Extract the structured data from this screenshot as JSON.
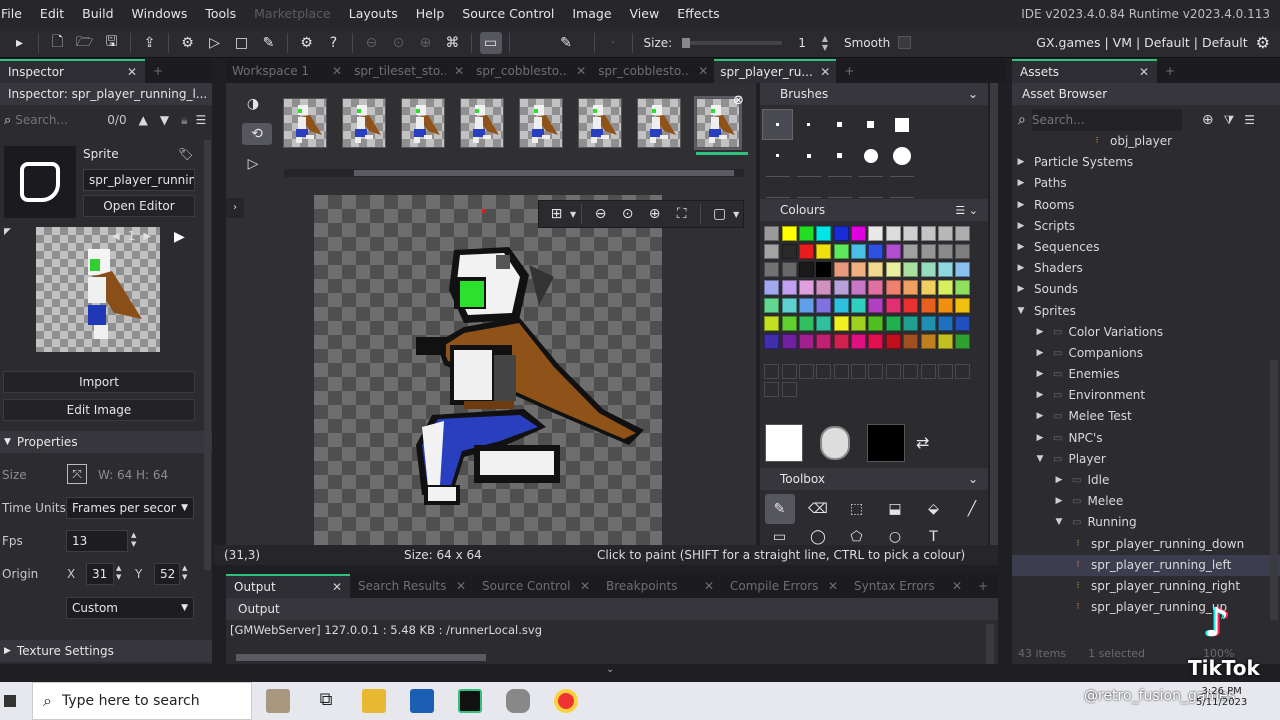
{
  "menu": {
    "items": [
      "File",
      "Edit",
      "Build",
      "Windows",
      "Tools",
      "Marketplace",
      "Layouts",
      "Help",
      "Source Control",
      "Image",
      "View",
      "Effects"
    ],
    "disabled_index": 5,
    "version": "IDE v2023.4.0.84  Runtime v2023.4.0.113"
  },
  "toolbar": {
    "size_label": "Size:",
    "size_value": "1",
    "smooth_label": "Smooth",
    "targets": "GX.games | VM | Default | Default"
  },
  "inspector": {
    "tab": "Inspector",
    "title": "Inspector: spr_player_running_l...",
    "search_placeholder": "Search...",
    "search_count": "0/0",
    "sprite_label": "Sprite",
    "sprite_name": "spr_player_running_",
    "open_editor": "Open Editor",
    "frame_number": "1",
    "import": "Import",
    "edit_image": "Edit Image",
    "properties": "Properties",
    "size_label": "Size",
    "width": "W: 64",
    "height": "H: 64",
    "time_units_label": "Time Units",
    "time_units_value": "Frames per second",
    "fps_label": "Fps",
    "fps_value": "13",
    "origin_label": "Origin",
    "origin_x_label": "X",
    "origin_x": "31",
    "origin_y_label": "Y",
    "origin_y": "52",
    "origin_preset": "Custom",
    "texture_settings": "Texture Settings"
  },
  "workspace_tabs": [
    {
      "label": "Workspace 1",
      "active": false
    },
    {
      "label": "spr_tileset_sto...",
      "active": false
    },
    {
      "label": "spr_cobblesto...",
      "active": false
    },
    {
      "label": "spr_cobblesto...",
      "active": false
    },
    {
      "label": "spr_player_ru...",
      "active": true
    }
  ],
  "editor": {
    "frames_count": 8,
    "status_coords": "(31,3)",
    "status_size": "Size: 64 x 64",
    "status_hint": "Click to paint (SHIFT for a straight line, CTRL to pick a colour)"
  },
  "brushes": {
    "title": "Brushes"
  },
  "colours": {
    "title": "Colours",
    "swatches": [
      "#9a9a9a",
      "#ffff00",
      "#22dd22",
      "#00e5e5",
      "#1a2bd8",
      "#e000e0",
      "#e8e8e8",
      "#dcdcdc",
      "#cfcfcf",
      "#c4c4c4",
      "#b8b8b8",
      "#adadad",
      "#a3a3a3",
      "#2a2a2a",
      "#e81c1c",
      "#f0e010",
      "#5ee85e",
      "#4ac0e8",
      "#3050e0",
      "#b050d0",
      "#a0a0a0",
      "#969696",
      "#8a8a8a",
      "#7e7e7e",
      "#727272",
      "#686868",
      "#1a1a1a",
      "#000000",
      "#e89a7c",
      "#f0b080",
      "#f0d890",
      "#e8f0a0",
      "#a8e0a0",
      "#98dcc0",
      "#90d8e0",
      "#88c0f0",
      "#a0a8f0",
      "#c0a0f0",
      "#e0a0e0",
      "#d090c0",
      "#b8a0d8",
      "#c878c8",
      "#e070a0",
      "#f08070",
      "#f0a060",
      "#f0d060",
      "#d8f060",
      "#90e060",
      "#60d890",
      "#60d0d0",
      "#60a0e8",
      "#8070e0",
      "#30c0e0",
      "#30d0c0",
      "#b040c0",
      "#e03070",
      "#e83030",
      "#e86020",
      "#f09010",
      "#f0c010",
      "#c0e020",
      "#60d030",
      "#30c060",
      "#30c0a0",
      "#f0f020",
      "#a0d020",
      "#50c020",
      "#20b050",
      "#20a090",
      "#2090b0",
      "#2070c0",
      "#2050c0",
      "#4030b0",
      "#7020a0",
      "#a02090",
      "#c02070",
      "#d02050",
      "#e01080",
      "#e01050",
      "#c01020",
      "#a05020",
      "#c08020",
      "#c0c020",
      "#30a030"
    ],
    "primary": "#ffffff",
    "secondary": "#000000"
  },
  "toolbox": {
    "title": "Toolbox"
  },
  "output": {
    "tabs": [
      {
        "label": "Output",
        "active": true
      },
      {
        "label": "Search Results",
        "active": false
      },
      {
        "label": "Source Control",
        "active": false
      },
      {
        "label": "Breakpoints",
        "active": false
      },
      {
        "label": "Compile Errors",
        "active": false
      },
      {
        "label": "Syntax Errors",
        "active": false
      }
    ],
    "header": "Output",
    "line": "[GMWebServer] 127.0.0.1 : 5.48 KB : /runnerLocal.svg"
  },
  "assets": {
    "tab": "Assets",
    "browser_title": "Asset Browser",
    "search_placeholder": "Search...",
    "items": [
      {
        "label": "obj_player",
        "depth": 4,
        "arrow": "",
        "selected": false
      },
      {
        "label": "Particle Systems",
        "depth": 0,
        "arrow": "right",
        "selected": false
      },
      {
        "label": "Paths",
        "depth": 0,
        "arrow": "right",
        "selected": false
      },
      {
        "label": "Rooms",
        "depth": 0,
        "arrow": "right",
        "selected": false
      },
      {
        "label": "Scripts",
        "depth": 0,
        "arrow": "right",
        "selected": false
      },
      {
        "label": "Sequences",
        "depth": 0,
        "arrow": "right",
        "selected": false
      },
      {
        "label": "Shaders",
        "depth": 0,
        "arrow": "right",
        "selected": false
      },
      {
        "label": "Sounds",
        "depth": 0,
        "arrow": "right",
        "selected": false
      },
      {
        "label": "Sprites",
        "depth": 0,
        "arrow": "down",
        "selected": false
      },
      {
        "label": "Color Variations",
        "depth": 1,
        "arrow": "right",
        "selected": false
      },
      {
        "label": "Companions",
        "depth": 1,
        "arrow": "right",
        "selected": false
      },
      {
        "label": "Enemies",
        "depth": 1,
        "arrow": "right",
        "selected": false
      },
      {
        "label": "Environment",
        "depth": 1,
        "arrow": "right",
        "selected": false
      },
      {
        "label": "Melee Test",
        "depth": 1,
        "arrow": "right",
        "selected": false
      },
      {
        "label": "NPC's",
        "depth": 1,
        "arrow": "right",
        "selected": false
      },
      {
        "label": "Player",
        "depth": 1,
        "arrow": "down",
        "selected": false
      },
      {
        "label": "Idle",
        "depth": 2,
        "arrow": "right",
        "selected": false
      },
      {
        "label": "Melee",
        "depth": 2,
        "arrow": "right",
        "selected": false
      },
      {
        "label": "Running",
        "depth": 2,
        "arrow": "down",
        "selected": false
      },
      {
        "label": "spr_player_running_down",
        "depth": 3,
        "arrow": "",
        "selected": false
      },
      {
        "label": "spr_player_running_left",
        "depth": 3,
        "arrow": "",
        "selected": true
      },
      {
        "label": "spr_player_running_right",
        "depth": 3,
        "arrow": "",
        "selected": false
      },
      {
        "label": "spr_player_running_up",
        "depth": 3,
        "arrow": "",
        "selected": false
      }
    ],
    "footer_items": "43 items",
    "footer_selected": "1 selected",
    "footer_zoom": "100%"
  },
  "taskbar": {
    "search_placeholder": "Type here to search",
    "time": "3:26 PM",
    "date": "5/11/2023"
  },
  "overlay": {
    "watermark_brand": "TikTok",
    "watermark_handle": "@retro_fusion_games"
  }
}
